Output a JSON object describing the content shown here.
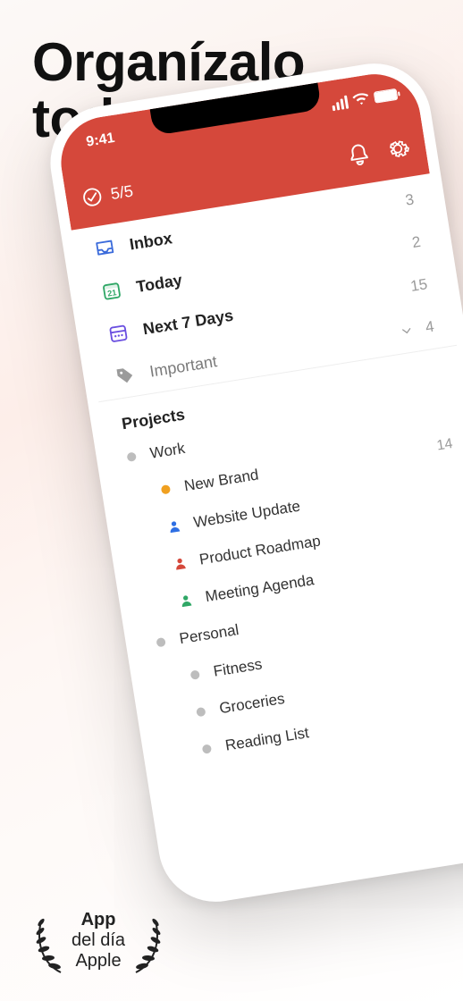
{
  "hero": {
    "line1": "Organízalo",
    "line2": "todo"
  },
  "award": {
    "line1": "App",
    "line2": "del día",
    "line3": "Apple"
  },
  "status": {
    "time": "9:41"
  },
  "header": {
    "progress_value": "5/5",
    "icons": {
      "bell": "bell-icon",
      "gear": "gear-icon",
      "ring": "progress-ring-icon"
    }
  },
  "smart_lists": [
    {
      "id": "inbox",
      "label": "Inbox",
      "count": "3",
      "icon": "inbox-icon",
      "color": "#3b6bdb"
    },
    {
      "id": "today",
      "label": "Today",
      "count": "2",
      "icon": "calendar-today-icon",
      "color": "#2fa766"
    },
    {
      "id": "next7",
      "label": "Next 7 Days",
      "count": "15",
      "icon": "calendar-week-icon",
      "color": "#6a4fe0"
    }
  ],
  "filter": {
    "label": "Important",
    "count": "4",
    "icon": "tag-icon",
    "chevron": "chevron-down-icon"
  },
  "projects_section": {
    "title": "Projects"
  },
  "projects": [
    {
      "label": "Work",
      "count": "",
      "depth": 0,
      "dot": "#bdbdbd",
      "avatar": null
    },
    {
      "label": "New Brand",
      "count": "14",
      "depth": 1,
      "dot": "#f0a020",
      "avatar": null
    },
    {
      "label": "Website Update",
      "count": "",
      "depth": 1,
      "dot": null,
      "avatar": "#2e6fe3"
    },
    {
      "label": "Product Roadmap",
      "count": "",
      "depth": 1,
      "dot": null,
      "avatar": "#d5483b"
    },
    {
      "label": "Meeting Agenda",
      "count": "",
      "depth": 1,
      "dot": null,
      "avatar": "#2fa766"
    },
    {
      "label": "Personal",
      "count": "",
      "depth": 0,
      "dot": "#bdbdbd",
      "avatar": null
    },
    {
      "label": "Fitness",
      "count": "",
      "depth": 1,
      "dot": "#bdbdbd",
      "avatar": null
    },
    {
      "label": "Groceries",
      "count": "",
      "depth": 1,
      "dot": "#bdbdbd",
      "avatar": null
    },
    {
      "label": "Reading List",
      "count": "",
      "depth": 1,
      "dot": "#bdbdbd",
      "avatar": null
    }
  ]
}
